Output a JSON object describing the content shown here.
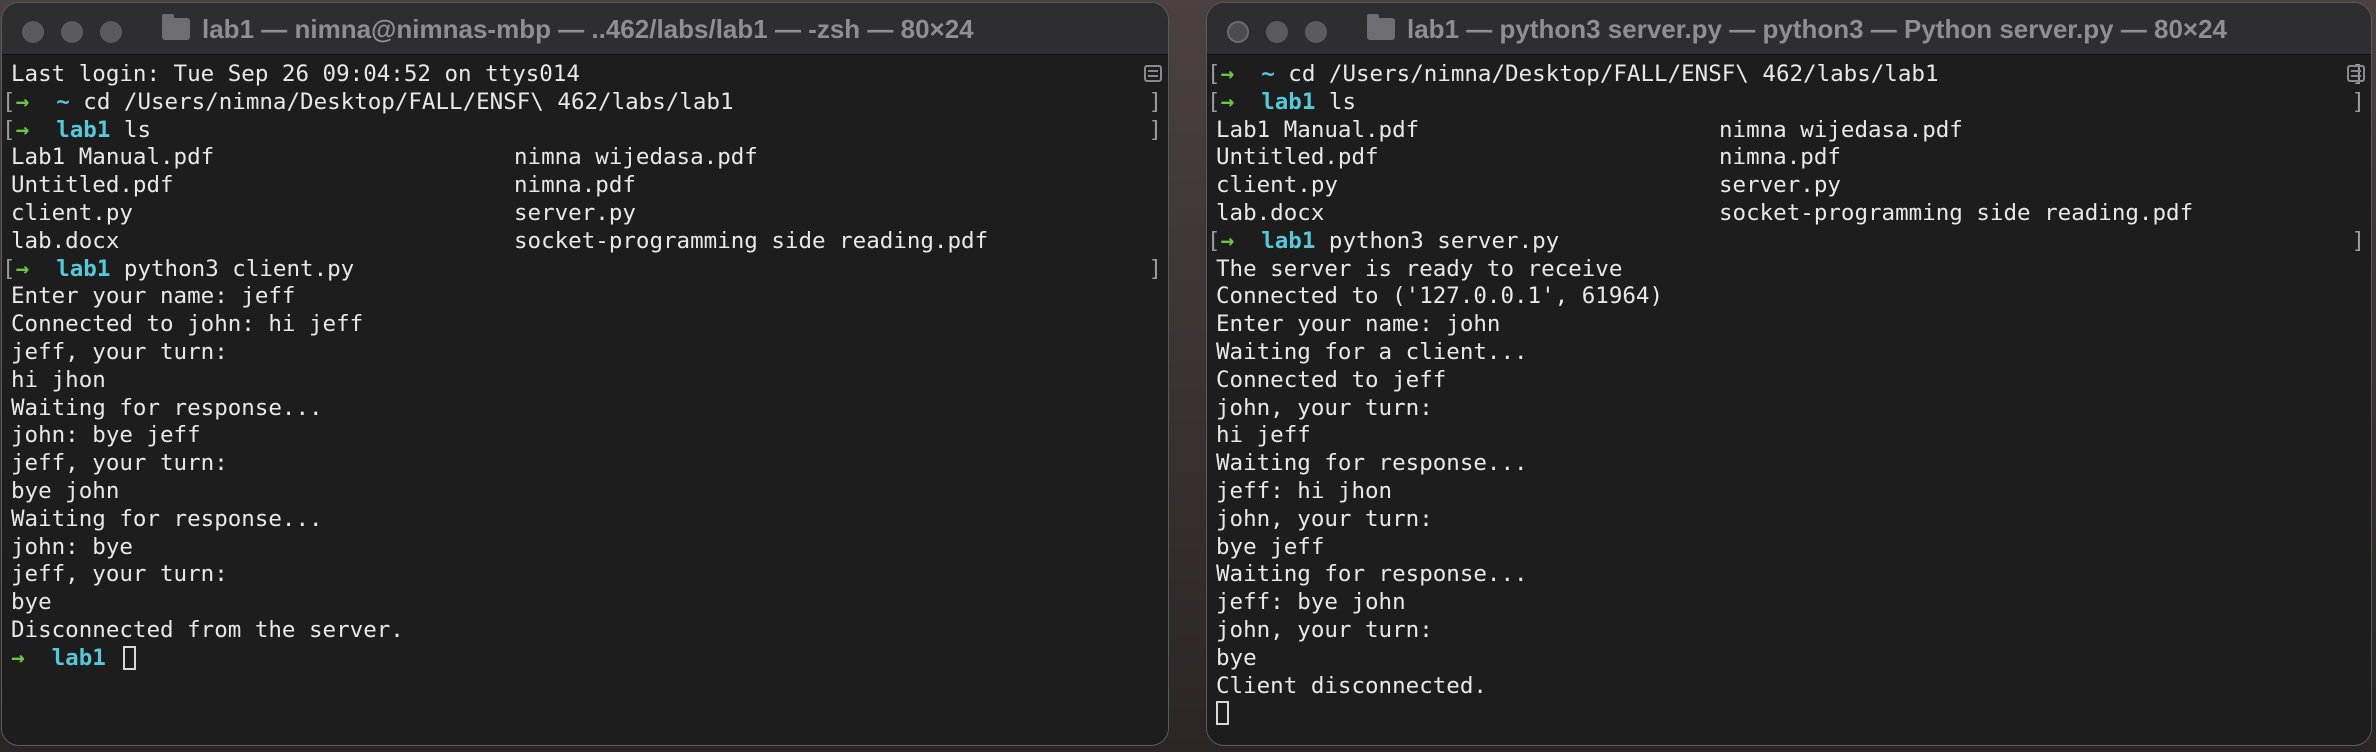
{
  "left_terminal": {
    "title": "lab1 — nimna@nimnas-mbp — ..462/labs/lab1 — -zsh — 80×24",
    "lines": [
      {
        "kind": "text",
        "text": "Last login: Tue Sep 26 09:04:52 on ttys014"
      },
      {
        "kind": "prompt",
        "arrow": "→",
        "dir": "~",
        "cmd": "cd /Users/nimna/Desktop/FALL/ENSF\\ 462/labs/lab1"
      },
      {
        "kind": "prompt",
        "arrow": "→",
        "dir": "lab1",
        "cmd": "ls"
      },
      {
        "kind": "cols",
        "left": "Lab1 Manual.pdf",
        "right": "nimna wijedasa.pdf"
      },
      {
        "kind": "cols",
        "left": "Untitled.pdf",
        "right": "nimna.pdf"
      },
      {
        "kind": "cols",
        "left": "client.py",
        "right": "server.py"
      },
      {
        "kind": "cols",
        "left": "lab.docx",
        "right": "socket-programming side reading.pdf"
      },
      {
        "kind": "prompt",
        "arrow": "→",
        "dir": "lab1",
        "cmd": "python3 client.py"
      },
      {
        "kind": "text",
        "text": "Enter your name: jeff"
      },
      {
        "kind": "text",
        "text": "Connected to john: hi jeff"
      },
      {
        "kind": "text",
        "text": "jeff, your turn:"
      },
      {
        "kind": "text",
        "text": "hi jhon"
      },
      {
        "kind": "text",
        "text": "Waiting for response..."
      },
      {
        "kind": "text",
        "text": "john: bye jeff"
      },
      {
        "kind": "text",
        "text": "jeff, your turn:"
      },
      {
        "kind": "text",
        "text": "bye john"
      },
      {
        "kind": "text",
        "text": "Waiting for response..."
      },
      {
        "kind": "text",
        "text": "john: bye"
      },
      {
        "kind": "text",
        "text": "jeff, your turn:"
      },
      {
        "kind": "text",
        "text": "bye"
      },
      {
        "kind": "text",
        "text": "Disconnected from the server."
      },
      {
        "kind": "active",
        "arrow": "→",
        "dir": "lab1",
        "cmd": ""
      }
    ]
  },
  "right_terminal": {
    "title": "lab1 — python3 server.py — python3 — Python server.py — 80×24",
    "lines": [
      {
        "kind": "prompt",
        "arrow": "→",
        "dir": "~",
        "cmd": "cd /Users/nimna/Desktop/FALL/ENSF\\ 462/labs/lab1"
      },
      {
        "kind": "prompt",
        "arrow": "→",
        "dir": "lab1",
        "cmd": "ls"
      },
      {
        "kind": "cols",
        "left": "Lab1 Manual.pdf",
        "right": "nimna wijedasa.pdf"
      },
      {
        "kind": "cols",
        "left": "Untitled.pdf",
        "right": "nimna.pdf"
      },
      {
        "kind": "cols",
        "left": "client.py",
        "right": "server.py"
      },
      {
        "kind": "cols",
        "left": "lab.docx",
        "right": "socket-programming side reading.pdf"
      },
      {
        "kind": "prompt",
        "arrow": "→",
        "dir": "lab1",
        "cmd": "python3 server.py"
      },
      {
        "kind": "text",
        "text": "The server is ready to receive"
      },
      {
        "kind": "text",
        "text": "Connected to ('127.0.0.1', 61964)"
      },
      {
        "kind": "text",
        "text": "Enter your name: john"
      },
      {
        "kind": "text",
        "text": "Waiting for a client..."
      },
      {
        "kind": "text",
        "text": "Connected to jeff"
      },
      {
        "kind": "text",
        "text": "john, your turn:"
      },
      {
        "kind": "text",
        "text": "hi jeff"
      },
      {
        "kind": "text",
        "text": "Waiting for response..."
      },
      {
        "kind": "text",
        "text": "jeff: hi jhon"
      },
      {
        "kind": "text",
        "text": "john, your turn:"
      },
      {
        "kind": "text",
        "text": "bye jeff"
      },
      {
        "kind": "text",
        "text": "Waiting for response..."
      },
      {
        "kind": "text",
        "text": "jeff: bye john"
      },
      {
        "kind": "text",
        "text": "john, your turn:"
      },
      {
        "kind": "text",
        "text": "bye"
      },
      {
        "kind": "text",
        "text": "Client disconnected."
      },
      {
        "kind": "cursor"
      }
    ]
  }
}
